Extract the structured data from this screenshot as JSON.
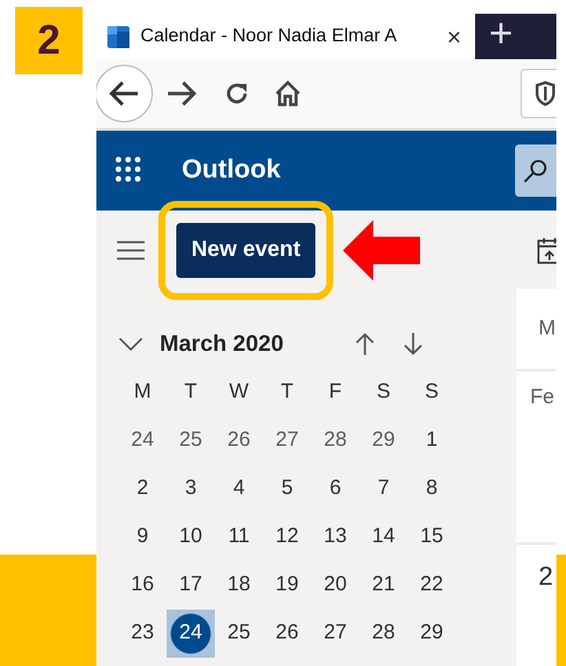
{
  "step_badge": "2",
  "browser": {
    "tab": {
      "title": "Calendar - Noor Nadia Elmar A",
      "close": "×",
      "selected": true
    },
    "new_tab": "+"
  },
  "app": {
    "title": "Outlook"
  },
  "command_bar": {
    "new_event": "New event",
    "highlighted": true
  },
  "mini_calendar": {
    "month": "March 2020",
    "weekdays": [
      "M",
      "T",
      "W",
      "T",
      "F",
      "S",
      "S"
    ],
    "weeks": [
      [
        {
          "day": "24",
          "other_month": true,
          "selected": false
        },
        {
          "day": "25",
          "other_month": true,
          "selected": false
        },
        {
          "day": "26",
          "other_month": true,
          "selected": false
        },
        {
          "day": "27",
          "other_month": true,
          "selected": false
        },
        {
          "day": "28",
          "other_month": true,
          "selected": false
        },
        {
          "day": "29",
          "other_month": true,
          "selected": false
        },
        {
          "day": "1",
          "other_month": false,
          "selected": false
        }
      ],
      [
        {
          "day": "2",
          "other_month": false,
          "selected": false
        },
        {
          "day": "3",
          "other_month": false,
          "selected": false
        },
        {
          "day": "4",
          "other_month": false,
          "selected": false
        },
        {
          "day": "5",
          "other_month": false,
          "selected": false
        },
        {
          "day": "6",
          "other_month": false,
          "selected": false
        },
        {
          "day": "7",
          "other_month": false,
          "selected": false
        },
        {
          "day": "8",
          "other_month": false,
          "selected": false
        }
      ],
      [
        {
          "day": "9",
          "other_month": false,
          "selected": false
        },
        {
          "day": "10",
          "other_month": false,
          "selected": false
        },
        {
          "day": "11",
          "other_month": false,
          "selected": false
        },
        {
          "day": "12",
          "other_month": false,
          "selected": false
        },
        {
          "day": "13",
          "other_month": false,
          "selected": false
        },
        {
          "day": "14",
          "other_month": false,
          "selected": false
        },
        {
          "day": "15",
          "other_month": false,
          "selected": false
        }
      ],
      [
        {
          "day": "16",
          "other_month": false,
          "selected": false
        },
        {
          "day": "17",
          "other_month": false,
          "selected": false
        },
        {
          "day": "18",
          "other_month": false,
          "selected": false
        },
        {
          "day": "19",
          "other_month": false,
          "selected": false
        },
        {
          "day": "20",
          "other_month": false,
          "selected": false
        },
        {
          "day": "21",
          "other_month": false,
          "selected": false
        },
        {
          "day": "22",
          "other_month": false,
          "selected": false
        }
      ],
      [
        {
          "day": "23",
          "other_month": false,
          "selected": false
        },
        {
          "day": "24",
          "other_month": false,
          "selected": true
        },
        {
          "day": "25",
          "other_month": false,
          "selected": false
        },
        {
          "day": "26",
          "other_month": false,
          "selected": false
        },
        {
          "day": "27",
          "other_month": false,
          "selected": false
        },
        {
          "day": "28",
          "other_month": false,
          "selected": false
        },
        {
          "day": "29",
          "other_month": false,
          "selected": false
        }
      ]
    ]
  },
  "day_view": {
    "column_header": "M",
    "row_1": "Fe",
    "row_2": "2"
  }
}
